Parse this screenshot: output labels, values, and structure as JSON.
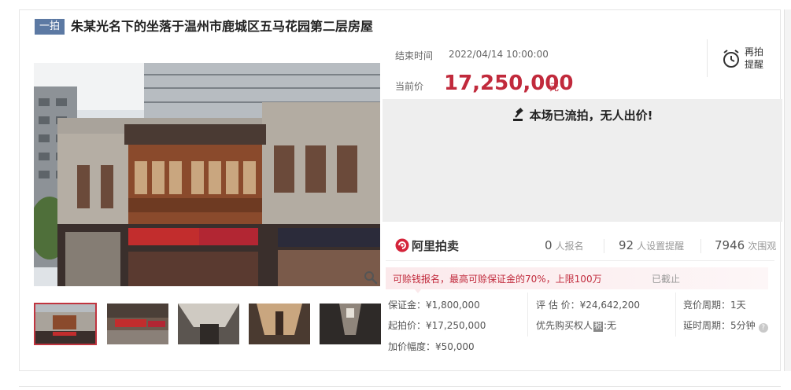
{
  "title": {
    "badge": "一拍",
    "text": "朱某光名下的坐落于温州市鹿城区五马花园第二层房屋"
  },
  "auction": {
    "end_label": "结束时间",
    "end_value": "2022/04/14 10:00:00",
    "price_label": "当前价",
    "price_value": "17,250,000",
    "price_unit": "元",
    "status_text": "本场已流拍，无人出价!"
  },
  "reminder": {
    "line1": "再拍",
    "line2": "提醒"
  },
  "platform": {
    "name": "阿里拍卖"
  },
  "stats": {
    "signup_count": "0",
    "signup_label": "人报名",
    "reminder_count": "92",
    "reminder_label": "人设置提醒",
    "view_count": "7946",
    "view_label": "次围观"
  },
  "notice": {
    "text": "可赊钱报名，最高可赊保证金的70%，上限100万",
    "status": "已截止"
  },
  "details": {
    "deposit": "保证金：¥1,800,000",
    "appraisal": "评 估 价：¥24,642,200",
    "cycle": "竞价周期：1天",
    "start_price": "起拍价：¥17,250,000",
    "priority_label": "优先购买权人",
    "priority_tag": "税",
    "priority_value": ":无",
    "delay": "延时周期：5分钟",
    "increment": "加价幅度：¥50,000"
  },
  "icons": {
    "zoom": "magnifier-icon",
    "alarm": "alarm-clock-icon",
    "gavel": "gavel-icon",
    "brand_logo": "ali-auction-logo-icon",
    "help": "question-icon"
  },
  "colors": {
    "accent_red": "#c12a3c",
    "badge_blue": "#5c79a3",
    "status_bg": "#eeeeee"
  }
}
